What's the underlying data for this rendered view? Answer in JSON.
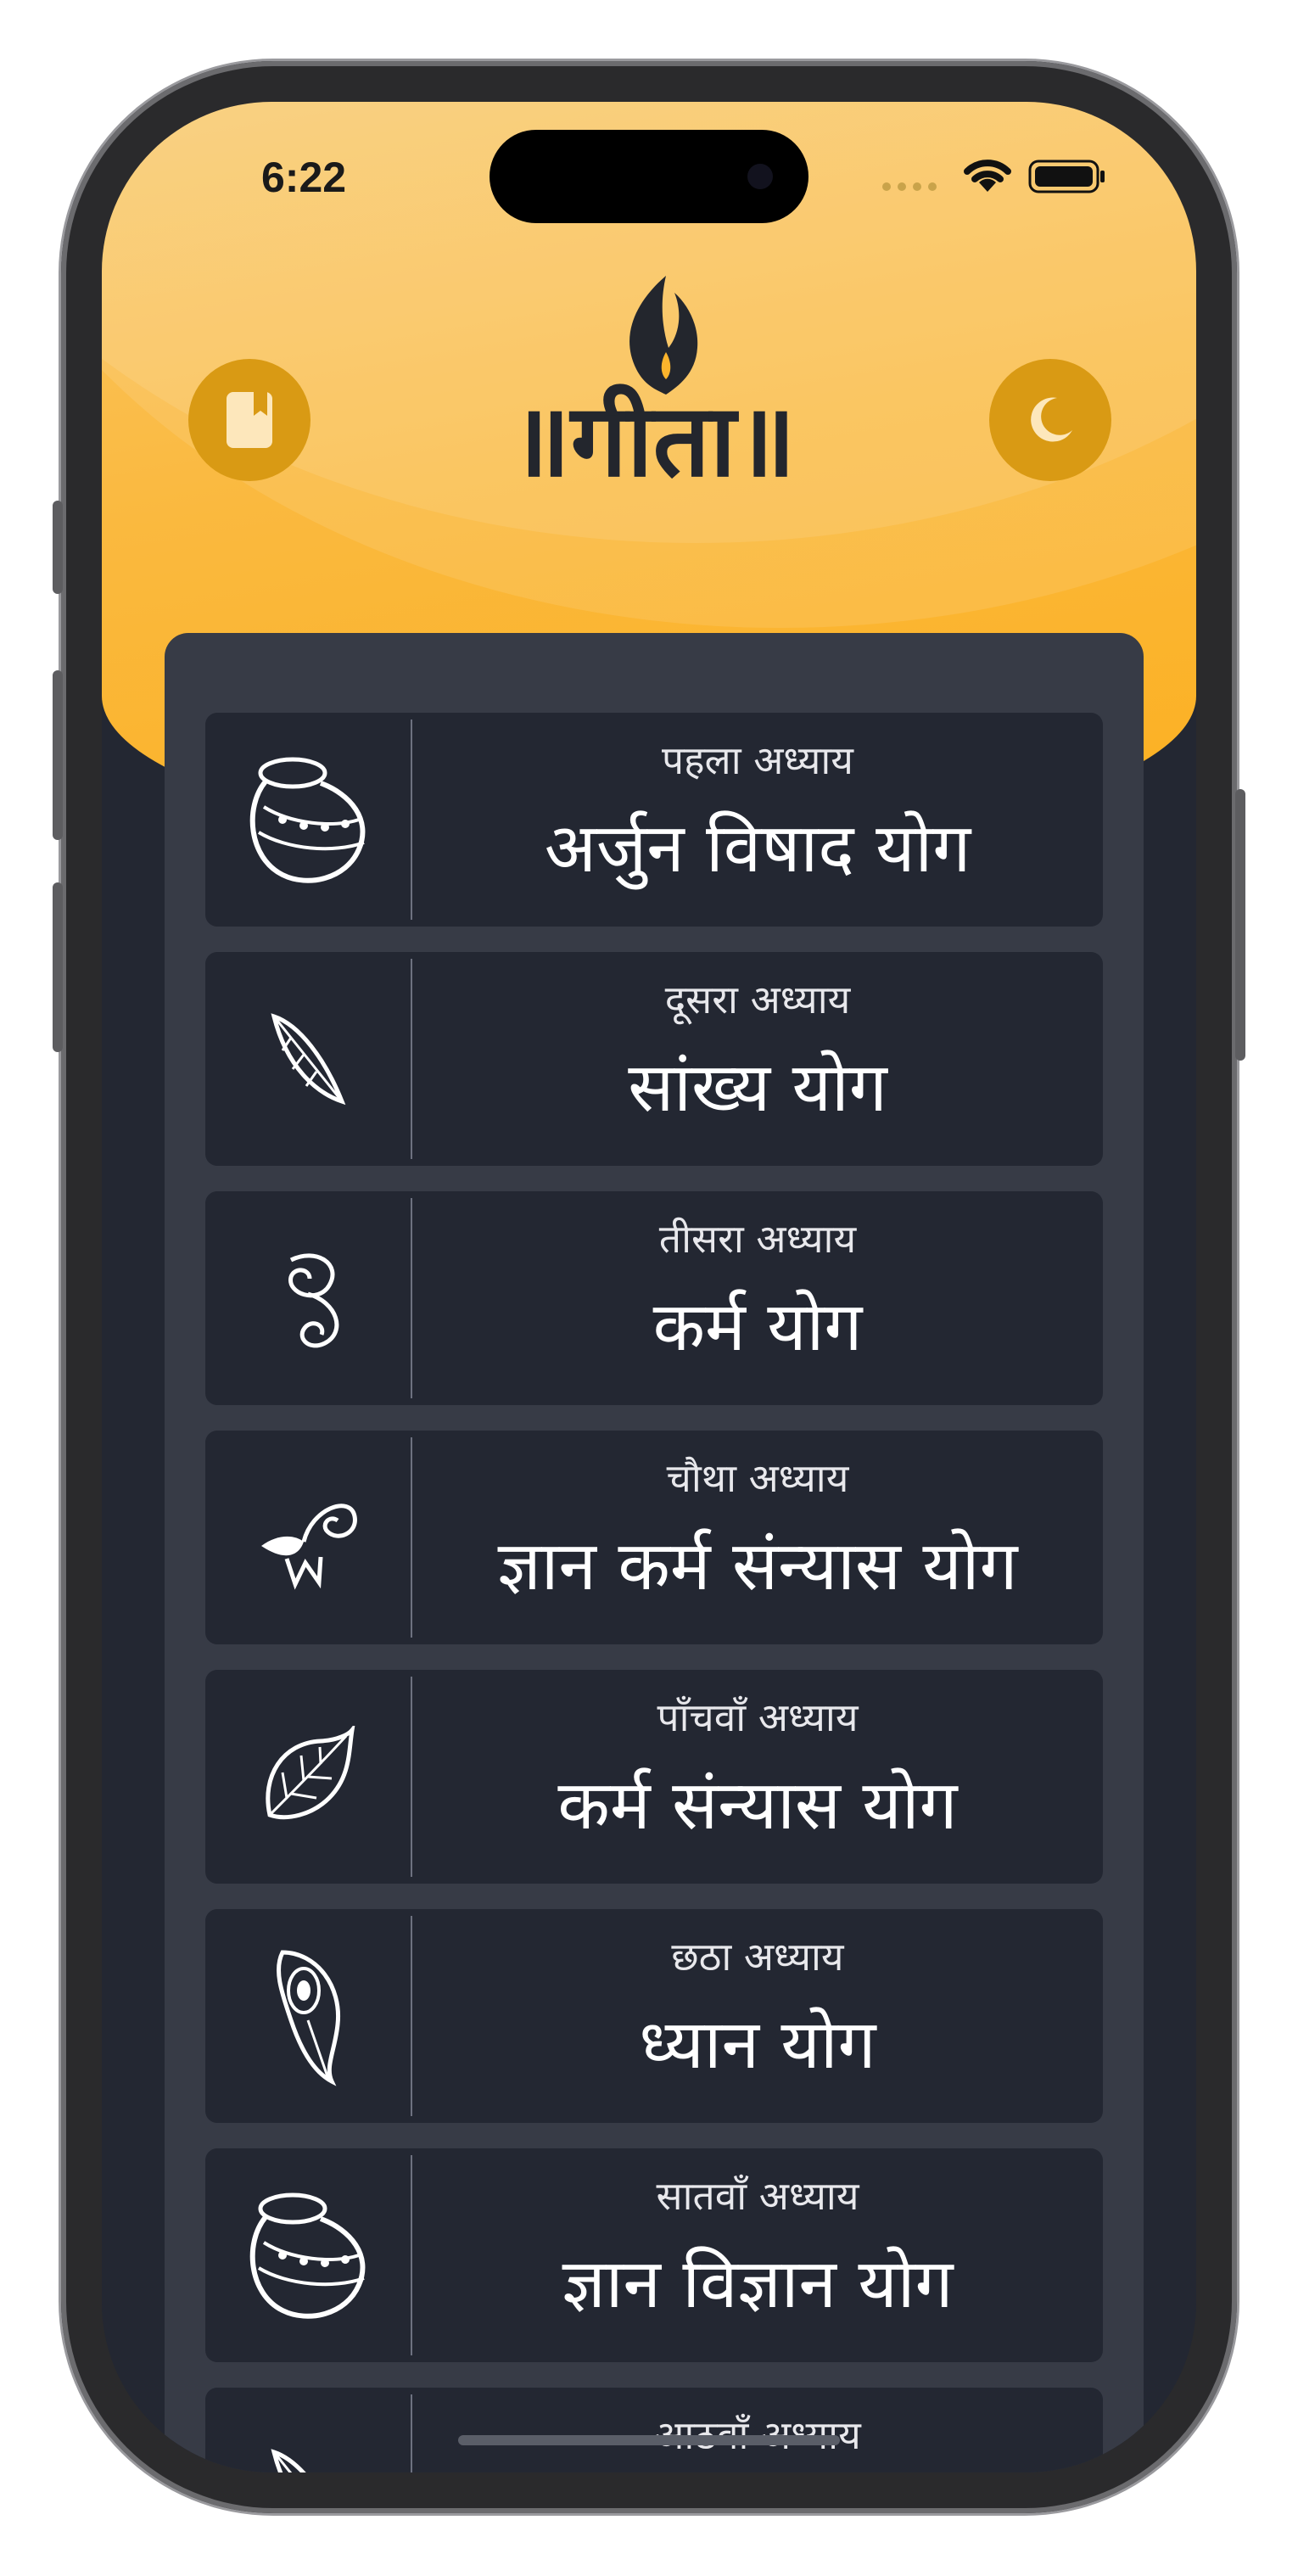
{
  "status_bar": {
    "time": "6:22"
  },
  "header": {
    "logo_text": "॥गीता॥",
    "left_button_icon": "bookmark-book-icon",
    "right_button_icon": "crescent-moon-icon",
    "button_color": "#d99a14",
    "accent_color": "#fbb42c"
  },
  "chapters": [
    {
      "number_label": "पहला अध्याय",
      "title": "अर्जुन विषाद योग",
      "icon": "pot-icon"
    },
    {
      "number_label": "दूसरा अध्याय",
      "title": "सांख्य योग",
      "icon": "feather-icon"
    },
    {
      "number_label": "तीसरा अध्याय",
      "title": "कर्म योग",
      "icon": "paisley-swirl-icon"
    },
    {
      "number_label": "चौथा अध्याय",
      "title": "ज्ञान कर्म संन्यास योग",
      "icon": "lotus-paisley-icon"
    },
    {
      "number_label": "पाँचवाँ अध्याय",
      "title": "कर्म संन्यास योग",
      "icon": "leaf-icon"
    },
    {
      "number_label": "छठा अध्याय",
      "title": "ध्यान योग",
      "icon": "peacock-feather-icon"
    },
    {
      "number_label": "सातवाँ अध्याय",
      "title": "ज्ञान विज्ञान योग",
      "icon": "pot-icon"
    },
    {
      "number_label": "आठवाँ अध्याय",
      "title": "",
      "icon": "feather-icon"
    }
  ]
}
